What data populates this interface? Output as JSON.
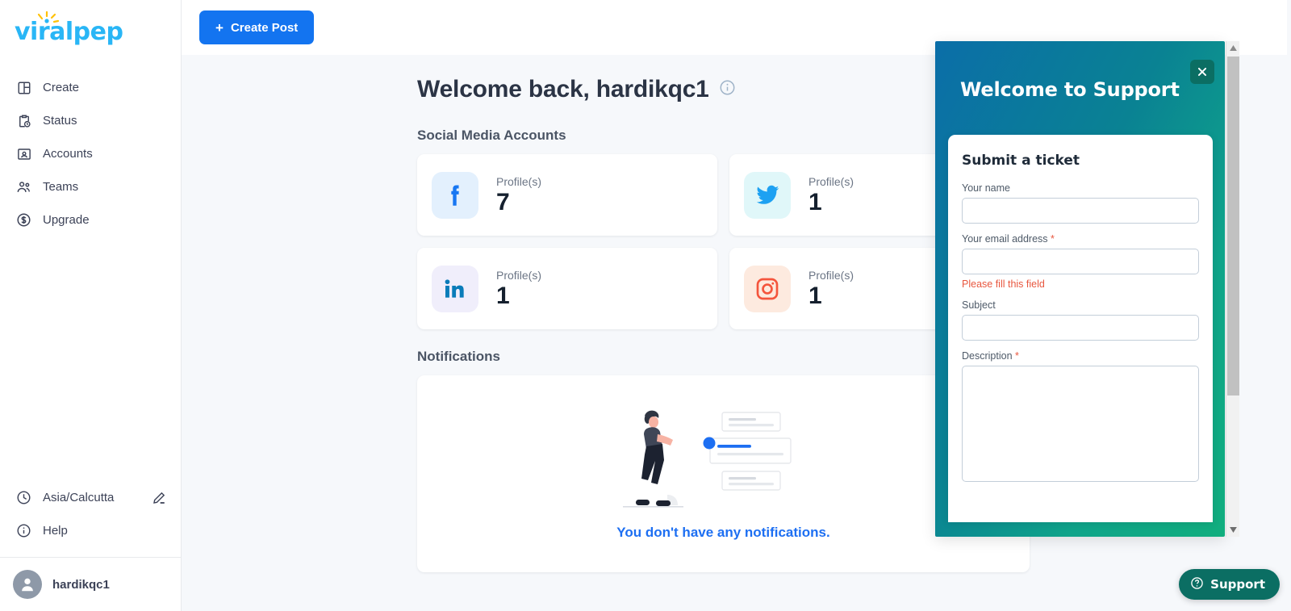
{
  "brand": {
    "name": "viralpep",
    "color": "#29b6f6",
    "accent": "#ffc107"
  },
  "sidebar": {
    "items": [
      {
        "label": "Create",
        "icon": "layout-icon"
      },
      {
        "label": "Status",
        "icon": "clipboard-clock-icon"
      },
      {
        "label": "Accounts",
        "icon": "id-card-icon"
      },
      {
        "label": "Teams",
        "icon": "users-icon"
      },
      {
        "label": "Upgrade",
        "icon": "dollar-circle-icon"
      }
    ],
    "timezone": {
      "label": "Asia/Calcutta",
      "icon": "clock-icon",
      "edit_icon": "pencil-icon"
    },
    "help": {
      "label": "Help",
      "icon": "info-circle-icon"
    },
    "user": {
      "name": "hardikqc1",
      "icon": "avatar-person-icon"
    }
  },
  "topbar": {
    "create_post_label": "Create Post",
    "plus": "+"
  },
  "main": {
    "welcome_title": "Welcome back, hardikqc1",
    "welcome_info_icon": "info-circle-icon",
    "accounts_section_title": "Social Media Accounts",
    "accounts": [
      {
        "network": "facebook",
        "label": "Profile(s)",
        "count": "7",
        "icon_bg": "#e3f0fd",
        "icon_color": "#1877f2"
      },
      {
        "network": "twitter",
        "label": "Profile(s)",
        "count": "1",
        "icon_bg": "#e0f7f9",
        "icon_color": "#1da1f2"
      },
      {
        "network": "linkedin",
        "label": "Profile(s)",
        "count": "1",
        "icon_bg": "#f0eefb",
        "icon_color": "#0a7cb9"
      },
      {
        "network": "instagram",
        "label": "Profile(s)",
        "count": "1",
        "icon_bg": "#fdeadf",
        "icon_color": "#f4553d"
      }
    ],
    "notifications_section_title": "Notifications",
    "notifications_empty_text": "You don't have any notifications.",
    "notifications_empty_color": "#1d6ff2"
  },
  "support_modal": {
    "header_title": "Welcome to Support",
    "close_icon": "close-icon",
    "form_title": "Submit a ticket",
    "fields": {
      "name": {
        "label": "Your name",
        "required": false,
        "value": ""
      },
      "email": {
        "label": "Your email address",
        "required": true,
        "value": "",
        "error": "Please fill this field"
      },
      "subject": {
        "label": "Subject",
        "required": false,
        "value": ""
      },
      "description": {
        "label": "Description",
        "required": true,
        "value": ""
      }
    },
    "required_marker": "*",
    "gradient_from": "#0b6ea8",
    "gradient_to": "#11ae7e"
  },
  "support_pill": {
    "label": "Support",
    "icon": "question-circle-icon",
    "color": "#0b6e63"
  },
  "scrollbar": {
    "up_icon": "caret-up-icon",
    "down_icon": "caret-down-icon"
  }
}
